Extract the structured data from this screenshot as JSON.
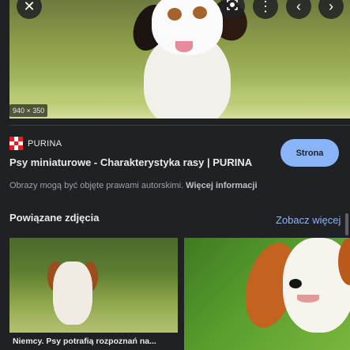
{
  "hero": {
    "size_label": "940 × 350"
  },
  "toolbar": {
    "close_icon": "close-icon",
    "lens_icon": "lens-icon",
    "more_icon": "more-vert-icon",
    "prev_icon": "chevron-left-icon",
    "next_icon": "chevron-right-icon"
  },
  "source": {
    "name": "PURINA",
    "title": "Psy miniaturowe - Charakterystyka rasy | PURINA",
    "visit_label": "Strona"
  },
  "copyright": {
    "text": "Obrazy mogą być objęte prawami autorskimi.",
    "more_link": "Więcej informacji"
  },
  "related": {
    "heading": "Powiązane zdjęcia",
    "see_more": "Zobacz więcej",
    "items": [
      {
        "caption": "Niemcy. Psy potrafią rozpoznań na..."
      },
      {
        "caption": ""
      }
    ]
  },
  "colors": {
    "accent": "#8ab4f8",
    "background": "#202124",
    "brand": "#e81c24"
  }
}
